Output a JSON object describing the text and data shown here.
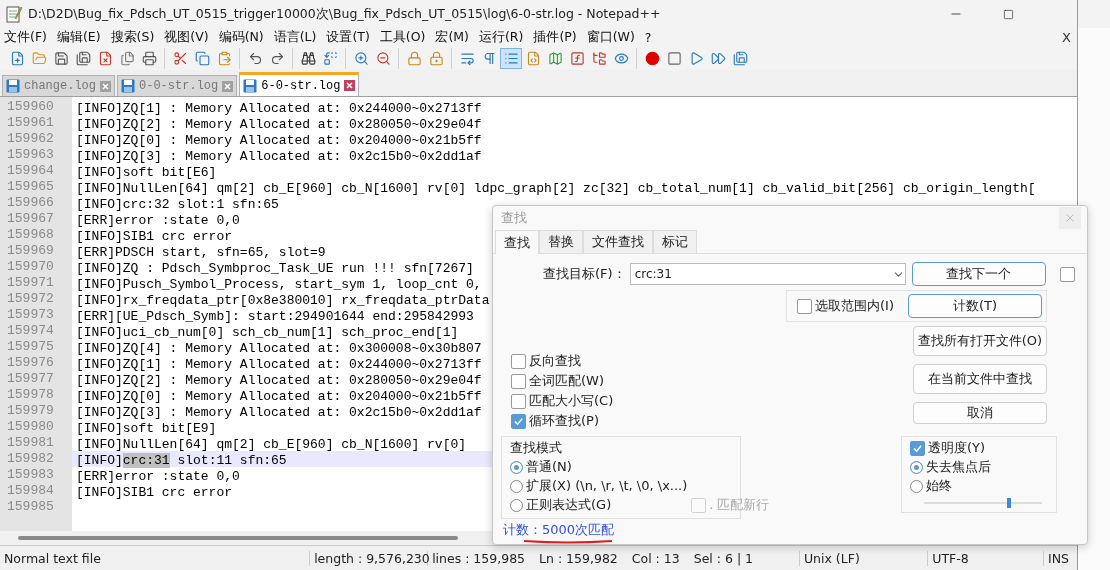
{
  "window": {
    "title": "D:\\D2D\\Bug_fix_Pdsch_UT_0515_trigger10000次\\Bug_fix_Pdsch_UT_0515\\log\\6-0-str.log - Notepad++"
  },
  "menu": [
    "文件(F)",
    "编辑(E)",
    "搜索(S)",
    "视图(V)",
    "编码(N)",
    "语言(L)",
    "设置(T)",
    "工具(O)",
    "宏(M)",
    "运行(R)",
    "插件(P)",
    "窗口(W)",
    "?"
  ],
  "menu_close": "X",
  "toolbar_groups": [
    [
      {
        "pressed": false
      },
      {
        "pressed": false
      },
      {
        "pressed": false
      },
      {
        "pressed": false
      },
      {
        "pressed": false
      },
      {
        "pressed": false
      },
      {
        "pressed": false
      }
    ],
    [
      {
        "pressed": false
      },
      {
        "pressed": false
      },
      {
        "pressed": false
      }
    ],
    [
      {
        "pressed": false
      },
      {
        "pressed": false
      }
    ],
    [
      {
        "pressed": false
      },
      {
        "pressed": false
      }
    ],
    [
      {
        "pressed": false
      },
      {
        "pressed": false
      }
    ],
    [
      {
        "pressed": false
      },
      {
        "pressed": false
      }
    ],
    [
      {
        "pressed": false
      },
      {
        "pressed": false
      },
      {
        "pressed": true
      },
      {
        "pressed": false
      },
      {
        "pressed": false
      },
      {
        "pressed": false
      },
      {
        "pressed": false
      },
      {
        "pressed": false
      }
    ],
    [
      {
        "pressed": false
      },
      {
        "pressed": false
      },
      {
        "pressed": false
      },
      {
        "pressed": false
      },
      {
        "pressed": false
      }
    ]
  ],
  "tabs": [
    {
      "label": "change.log",
      "selected": false
    },
    {
      "label": "0-0-str.log",
      "selected": false
    },
    {
      "label": "6-0-str.log",
      "selected": true
    }
  ],
  "editor": {
    "lines": [
      {
        "number": "159960",
        "text": "[INFO]ZQ[1] : Memory Allocated at: 0x244000~0x2713ff",
        "current": false
      },
      {
        "number": "159961",
        "text": "[INFO]ZQ[2] : Memory Allocated at: 0x280050~0x29e04f",
        "current": false
      },
      {
        "number": "159962",
        "text": "[INFO]ZQ[0] : Memory Allocated at: 0x204000~0x21b5ff",
        "current": false
      },
      {
        "number": "159963",
        "text": "[INFO]ZQ[3] : Memory Allocated at: 0x2c15b0~0x2dd1af",
        "current": false
      },
      {
        "number": "159964",
        "text": "[INFO]soft bit[E6]",
        "current": false
      },
      {
        "number": "159965",
        "text": "[INFO]NullLen[64] qm[2] cb_E[960] cb_N[1600] rv[0] ldpc_graph[2] zc[32] cb_total_num[1] cb_valid_bit[256] cb_origin_length[",
        "current": false
      },
      {
        "number": "159966",
        "text": "[INFO]crc:32 slot:1 sfn:65",
        "current": false
      },
      {
        "number": "159967",
        "text": "[ERR]error :state 0,0",
        "current": false
      },
      {
        "number": "159968",
        "text": "[INFO]SIB1 crc error",
        "current": false
      },
      {
        "number": "159969",
        "text": "[ERR]PDSCH start, sfn=65, slot=9",
        "current": false
      },
      {
        "number": "159970",
        "text": "[INFO]ZQ : Pdsch_Symbproc_Task_UE run !!! sfn[7267]",
        "current": false
      },
      {
        "number": "159971",
        "text": "[INFO]Pusch_Symbol_Process, start_sym 1, loop_cnt 0,",
        "current": false
      },
      {
        "number": "159972",
        "text": "[INFO]rx_freqdata_ptr[0x8e380010] rx_freqdata_ptrData",
        "current": false
      },
      {
        "number": "159973",
        "text": "[ERR][UE_Pdsch_Symb]: start:294901644 end:295842993",
        "current": false
      },
      {
        "number": "159974",
        "text": "[INFO]uci_cb_num[0] sch_cb_num[1] sch_proc_end[1]",
        "current": false
      },
      {
        "number": "159975",
        "text": "[INFO]ZQ[4] : Memory Allocated at: 0x300008~0x30b807",
        "current": false
      },
      {
        "number": "159976",
        "text": "[INFO]ZQ[1] : Memory Allocated at: 0x244000~0x2713ff",
        "current": false
      },
      {
        "number": "159977",
        "text": "[INFO]ZQ[2] : Memory Allocated at: 0x280050~0x29e04f",
        "current": false
      },
      {
        "number": "159978",
        "text": "[INFO]ZQ[0] : Memory Allocated at: 0x204000~0x21b5ff",
        "current": false
      },
      {
        "number": "159979",
        "text": "[INFO]ZQ[3] : Memory Allocated at: 0x2c15b0~0x2dd1af",
        "current": false
      },
      {
        "number": "159980",
        "text": "[INFO]soft bit[E9]",
        "current": false
      },
      {
        "number": "159981",
        "text": "[INFO]NullLen[64] qm[2] cb_E[960] cb_N[1600] rv[0]",
        "current": false
      },
      {
        "number": "159982",
        "segments": [
          {
            "text": "[INFO]",
            "found": false
          },
          {
            "text": "crc:31",
            "found": true
          },
          {
            "text": " slot:11 sfn:65",
            "found": false
          }
        ],
        "current": true
      },
      {
        "number": "159983",
        "text": "[ERR]error :state 0,0",
        "current": false
      },
      {
        "number": "159984",
        "text": "[INFO]SIB1 crc error",
        "current": false
      },
      {
        "number": "159985",
        "current": false
      }
    ]
  },
  "status_bar": [
    "Normal text file",
    "length : 9,576,230",
    "lines : 159,985",
    "Ln : 159,982",
    "Col : 13",
    "Sel : 6 | 1",
    "Unix (LF)",
    "UTF-8",
    "INS"
  ],
  "find_dialog": {
    "title": "查找",
    "tabs": [
      {
        "label": "查找",
        "selected": true
      },
      {
        "label": "替换",
        "selected": false
      },
      {
        "label": "文件查找",
        "selected": false
      },
      {
        "label": "标记",
        "selected": false
      }
    ],
    "target_label": "查找目标(F)：",
    "target_value": "crc:31",
    "side_checkbox": {
      "checked": false
    },
    "find_next": "查找下一个",
    "in_selection": {
      "label": "选取范围内(I)",
      "checked": false
    },
    "count_button": "计数(T)",
    "buttons": [
      "查找所有打开文件(O)",
      "在当前文件中查找",
      "取消"
    ],
    "options": [
      {
        "label": "反向查找",
        "checked": false
      },
      {
        "label": "全词匹配(W)",
        "checked": false
      },
      {
        "label": "匹配大小写(C)",
        "checked": false
      },
      {
        "label": "循环查找(P)",
        "checked": true
      }
    ],
    "mode": {
      "title": "查找模式",
      "options": [
        {
          "label": "普通(N)",
          "selected": true
        },
        {
          "label": "扩展(X) (\\n, \\r, \\t, \\0, \\x...)",
          "selected": false
        },
        {
          "label": "正则表达式(G)",
          "selected": false
        }
      ],
      "newline": {
        "label": ". 匹配新行",
        "checked": false,
        "disabled": true
      }
    },
    "transparency": {
      "label": "透明度(Y)",
      "checked": true,
      "options": [
        {
          "label": "失去焦点后",
          "selected": true
        },
        {
          "label": "始终",
          "selected": false
        }
      ],
      "level": 0.72
    },
    "status": "计数：5000次匹配"
  }
}
